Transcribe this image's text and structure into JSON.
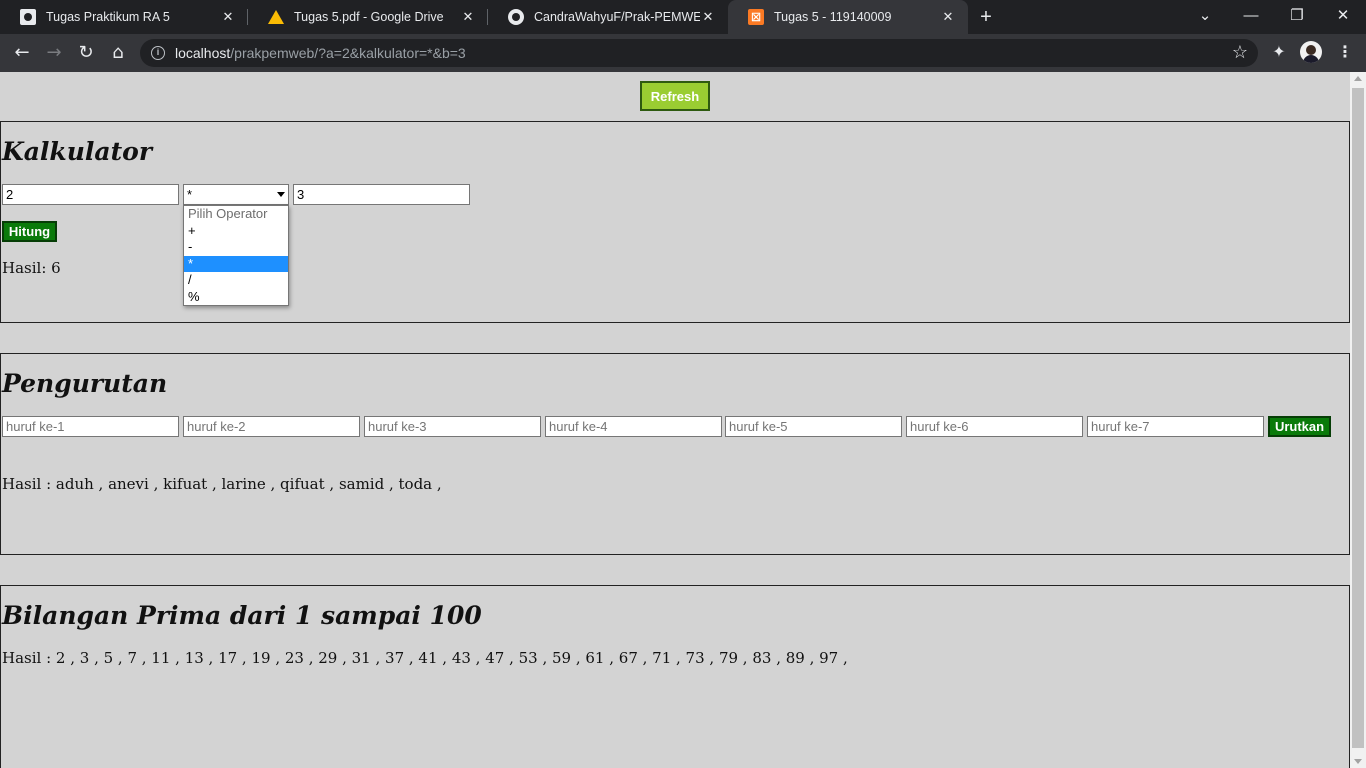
{
  "browser": {
    "tabs": [
      {
        "title": "Tugas Praktikum RA 5",
        "icon": "praktikum-favicon"
      },
      {
        "title": "Tugas 5.pdf - Google Drive",
        "icon": "google-drive-icon"
      },
      {
        "title": "CandraWahyuF/Prak-PEMWEB-RA",
        "icon": "github-icon"
      },
      {
        "title": "Tugas 5 - 119140009",
        "icon": "xampp-icon",
        "active": true
      }
    ],
    "url_host": "localhost",
    "url_path": "/prakpemweb/?a=2&kalkulator=*&b=3"
  },
  "page": {
    "refresh_label": "Refresh",
    "kalkulator": {
      "title": "Kalkulator",
      "a_value": "2",
      "operator_value": "*",
      "b_value": "3",
      "operator_options": [
        "Pilih Operator",
        "+",
        "-",
        "*",
        "/",
        "%"
      ],
      "hitung_label": "Hitung",
      "result": "Hasil: 6"
    },
    "pengurutan": {
      "title": "Pengurutan",
      "placeholders": [
        "huruf ke-1",
        "huruf ke-2",
        "huruf ke-3",
        "huruf ke-4",
        "huruf ke-5",
        "huruf ke-6",
        "huruf ke-7"
      ],
      "urutkan_label": "Urutkan",
      "result": "Hasil : aduh , anevi , kifuat , larine , qifuat , samid , toda ,"
    },
    "prima": {
      "title": "Bilangan Prima dari 1 sampai 100",
      "result": "Hasil : 2 , 3 , 5 , 7 , 11 , 13 , 17 , 19 , 23 , 29 , 31 , 37 , 41 , 43 , 47 , 53 , 59 , 61 , 67 , 71 , 73 , 79 , 83 , 89 , 97 ,"
    }
  },
  "colors": {
    "page_background": "#d3d3d3",
    "refresh_button": "#9acd32",
    "green_button": "#0a7a0a",
    "dropdown_highlight": "#1e90ff"
  }
}
